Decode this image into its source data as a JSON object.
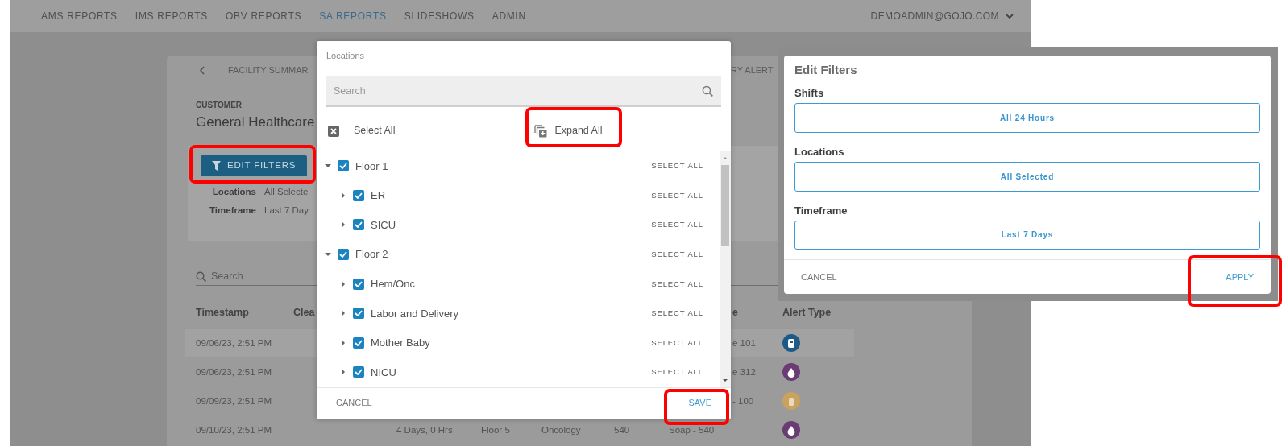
{
  "app": {
    "nav": {
      "items": [
        {
          "label": "AMS REPORTS",
          "selected": false
        },
        {
          "label": "IMS REPORTS",
          "selected": false
        },
        {
          "label": "OBV REPORTS",
          "selected": false
        },
        {
          "label": "SA REPORTS",
          "selected": true
        },
        {
          "label": "SLIDESHOWS",
          "selected": false
        },
        {
          "label": "ADMIN",
          "selected": false
        }
      ],
      "user": "DEMOADMIN@GOJO.COM"
    },
    "report": {
      "tabs": [
        {
          "label": "FACILITY SUMMAR"
        },
        {
          "label": "RY ALERT"
        }
      ],
      "customer_label": "CUSTOMER",
      "customer": "General Healthcare",
      "edit_filters_button": "EDIT FILTERS",
      "filters": [
        {
          "label": "Locations",
          "value": "All Selecte"
        },
        {
          "label": "Timeframe",
          "value": "Last 7 Day"
        }
      ],
      "search": {
        "placeholder": "Search"
      },
      "table": {
        "columns": [
          "Timestamp",
          "Clea",
          null,
          null,
          null,
          null,
          null,
          "e",
          "Alert Type"
        ],
        "rows": [
          {
            "cells": [
              "09/06/23, 2:51 PM",
              null,
              null,
              null,
              null,
              null,
              null,
              "e 101"
            ],
            "alert": {
              "kind": "dispenser",
              "color": "#1e5a85"
            }
          },
          {
            "cells": [
              "09/06/23, 2:51 PM",
              null,
              null,
              null,
              null,
              null,
              null,
              "e 312"
            ],
            "alert": {
              "kind": "drop",
              "color": "#6a3c74"
            }
          },
          {
            "cells": [
              "09/09/23, 2:51 PM",
              null,
              null,
              null,
              null,
              null,
              null,
              "- 100"
            ],
            "alert": {
              "kind": "bottle",
              "color": "#c9a25e"
            }
          },
          {
            "cells": [
              "09/10/23, 2:51 PM",
              null,
              "4 Days, 0 Hrs",
              "Floor 5",
              "Oncology",
              "540",
              "Soap - 540",
              null
            ],
            "alert": {
              "kind": "drop",
              "color": "#6a3c74"
            }
          }
        ]
      }
    },
    "locations_dialog": {
      "title": "Locations",
      "search": {
        "placeholder": "Search"
      },
      "select_all": "Select All",
      "expand_all": "Expand All",
      "tree": [
        {
          "label": "Floor 1",
          "checked": true,
          "expanded": true,
          "action": "SELECT ALL",
          "children": [
            {
              "label": "ER",
              "checked": true,
              "expanded": false,
              "action": "SELECT ALL"
            },
            {
              "label": "SICU",
              "checked": true,
              "expanded": false,
              "action": "SELECT ALL"
            }
          ]
        },
        {
          "label": "Floor 2",
          "checked": true,
          "expanded": true,
          "action": "SELECT ALL",
          "children": [
            {
              "label": "Hem/Onc",
              "checked": true,
              "expanded": false,
              "action": "SELECT ALL"
            },
            {
              "label": "Labor and Delivery",
              "checked": true,
              "expanded": false,
              "action": "SELECT ALL"
            },
            {
              "label": "Mother Baby",
              "checked": true,
              "expanded": false,
              "action": "SELECT ALL"
            },
            {
              "label": "NICU",
              "checked": true,
              "expanded": false,
              "action": "SELECT ALL"
            }
          ]
        }
      ],
      "cancel": "CANCEL",
      "save": "SAVE"
    }
  },
  "filters_panel": {
    "title": "Edit Filters",
    "fields": [
      {
        "label": "Shifts",
        "value": "All 24 Hours"
      },
      {
        "label": "Locations",
        "value": "All Selected"
      },
      {
        "label": "Timeframe",
        "value": "Last 7 Days"
      }
    ],
    "cancel": "CANCEL",
    "apply": "APPLY"
  }
}
